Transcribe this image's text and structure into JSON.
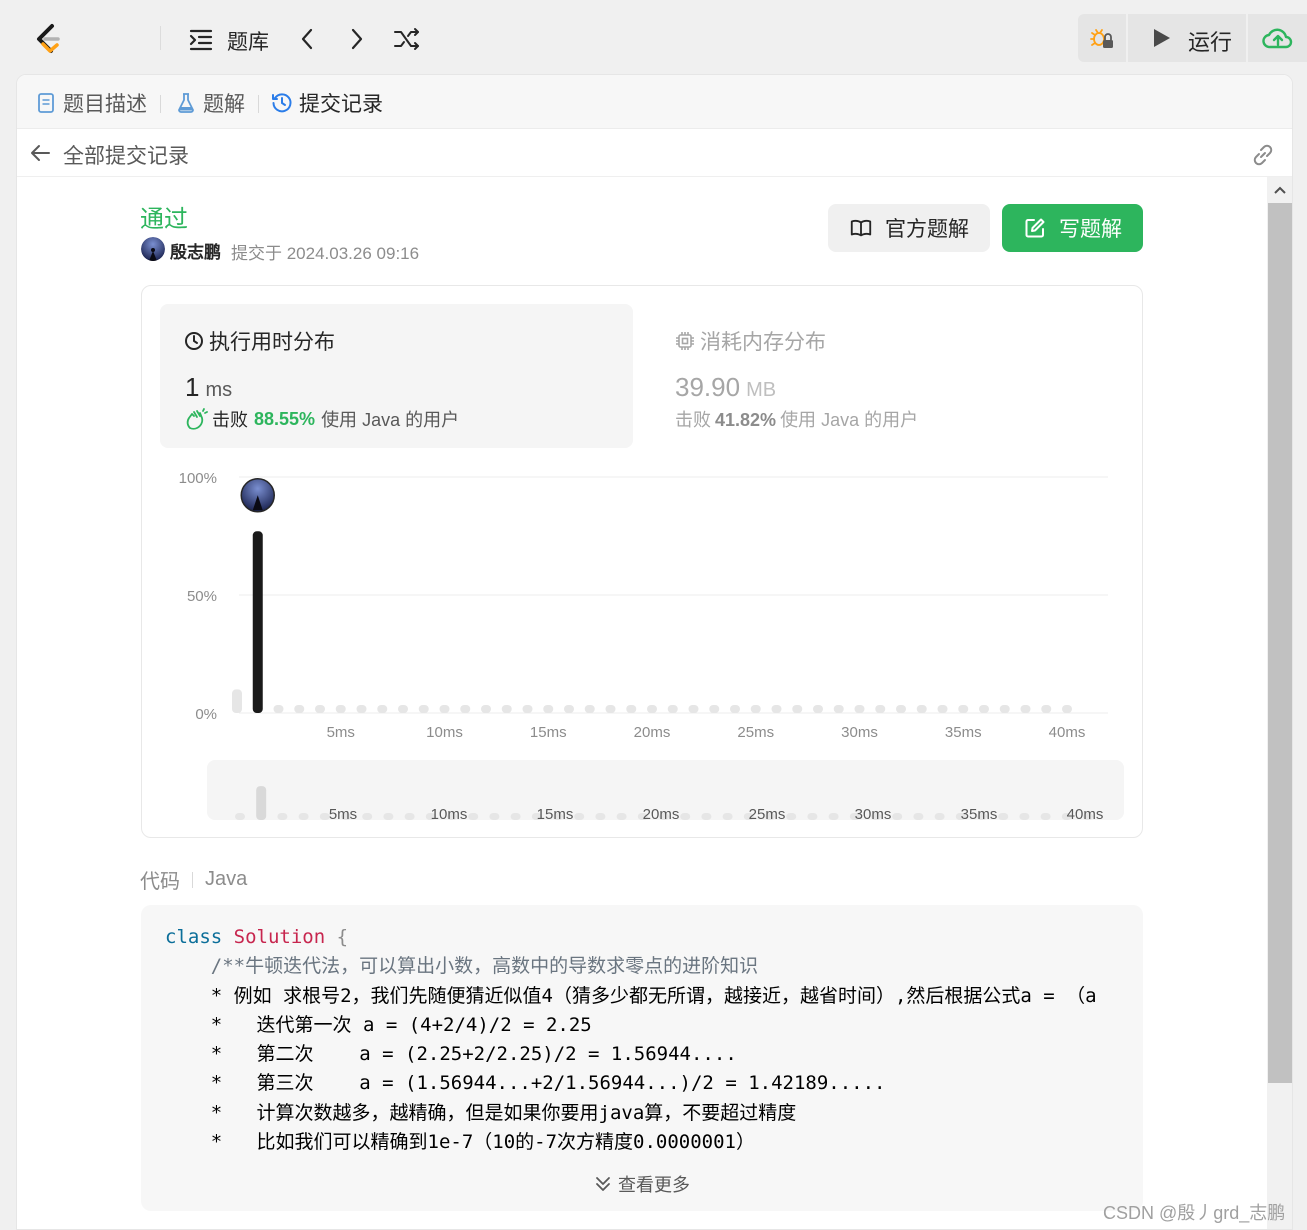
{
  "topnav": {
    "problems_label": "题库",
    "run_label": "运行"
  },
  "tabs": [
    {
      "label": "题目描述",
      "icon": "document-icon"
    },
    {
      "label": "题解",
      "icon": "flask-icon"
    },
    {
      "label": "提交记录",
      "icon": "history-icon"
    }
  ],
  "subheader": {
    "back_label": "全部提交记录"
  },
  "submission": {
    "status": "通过",
    "username": "殷志鹏",
    "submitted_text": "提交于 2024.03.26 09:16",
    "official_solution_label": "官方题解",
    "write_solution_label": "写题解"
  },
  "runtime": {
    "title": "执行用时分布",
    "value": "1",
    "unit": "ms",
    "beats_label": "击败",
    "beats_pct": "88.55%",
    "beats_rest": "使用 Java 的用户"
  },
  "memory": {
    "title": "消耗内存分布",
    "value": "39.90",
    "unit": "MB",
    "beats_label": "击败",
    "beats_pct": "41.82%",
    "beats_rest": "使用 Java 的用户"
  },
  "chart_data": {
    "type": "bar",
    "title": "",
    "xlabel": "",
    "ylabel": "",
    "y_ticks": [
      "100%",
      "50%",
      "0%"
    ],
    "ylim": [
      0,
      100
    ],
    "x_ticks": [
      "5ms",
      "10ms",
      "15ms",
      "20ms",
      "25ms",
      "30ms",
      "35ms",
      "40ms"
    ],
    "x_tick_values": [
      5,
      10,
      15,
      20,
      25,
      30,
      35,
      40
    ],
    "categories_ms": [
      0,
      1,
      2,
      3,
      4,
      5,
      6,
      7,
      8,
      9,
      10,
      11,
      12,
      13,
      14,
      15,
      16,
      17,
      18,
      19,
      20,
      21,
      22,
      23,
      24,
      25,
      26,
      27,
      28,
      29,
      30,
      31,
      32,
      33,
      34,
      35,
      36,
      37,
      38,
      39,
      40
    ],
    "values": [
      10,
      77,
      0,
      0,
      0,
      0,
      0,
      0,
      0,
      0,
      0,
      0,
      0,
      0,
      0,
      0,
      0,
      0,
      0,
      0,
      0,
      0,
      0,
      0,
      0,
      0,
      0,
      0,
      0,
      0,
      0,
      0,
      0,
      0,
      0,
      0,
      0,
      0,
      0,
      0,
      0
    ],
    "highlight_ms": 1,
    "grid": true,
    "colors": {
      "highlight": "#1a1a1a",
      "other": "#e6e6e6"
    }
  },
  "code": {
    "label": "代码",
    "language": "Java",
    "expand_label": "查看更多",
    "lines": [
      [
        {
          "t": "class ",
          "c": "kw"
        },
        {
          "t": "Solution",
          "c": "cls"
        },
        {
          "t": " {",
          "c": "brace"
        }
      ],
      [
        {
          "t": "    /**牛顿迭代法，可以算出小数，高数中的导数求零点的进阶知识",
          "c": "cmt"
        }
      ],
      [
        {
          "t": "    * 例如 求根号2，我们先随便猜近似值4（猜多少都无所谓，越接近，越省时间）,然后根据公式a = （a",
          "c": ""
        }
      ],
      [
        {
          "t": "    *   迭代第一次 a = (4+2/4)/2 = 2.25",
          "c": ""
        }
      ],
      [
        {
          "t": "    *   第二次    a = (2.25+2/2.25)/2 = 1.56944....",
          "c": ""
        }
      ],
      [
        {
          "t": "    *   第三次    a = (1.56944...+2/1.56944...)/2 = 1.42189.....",
          "c": ""
        }
      ],
      [
        {
          "t": "    *   计算次数越多，越精确，但是如果你要用java算，不要超过精度",
          "c": ""
        }
      ],
      [
        {
          "t": "    *   比如我们可以精确到1e-7（10的-7次方精度0.0000001）",
          "c": ""
        }
      ]
    ]
  },
  "watermark": "CSDN @殷丿grd_志鹏"
}
